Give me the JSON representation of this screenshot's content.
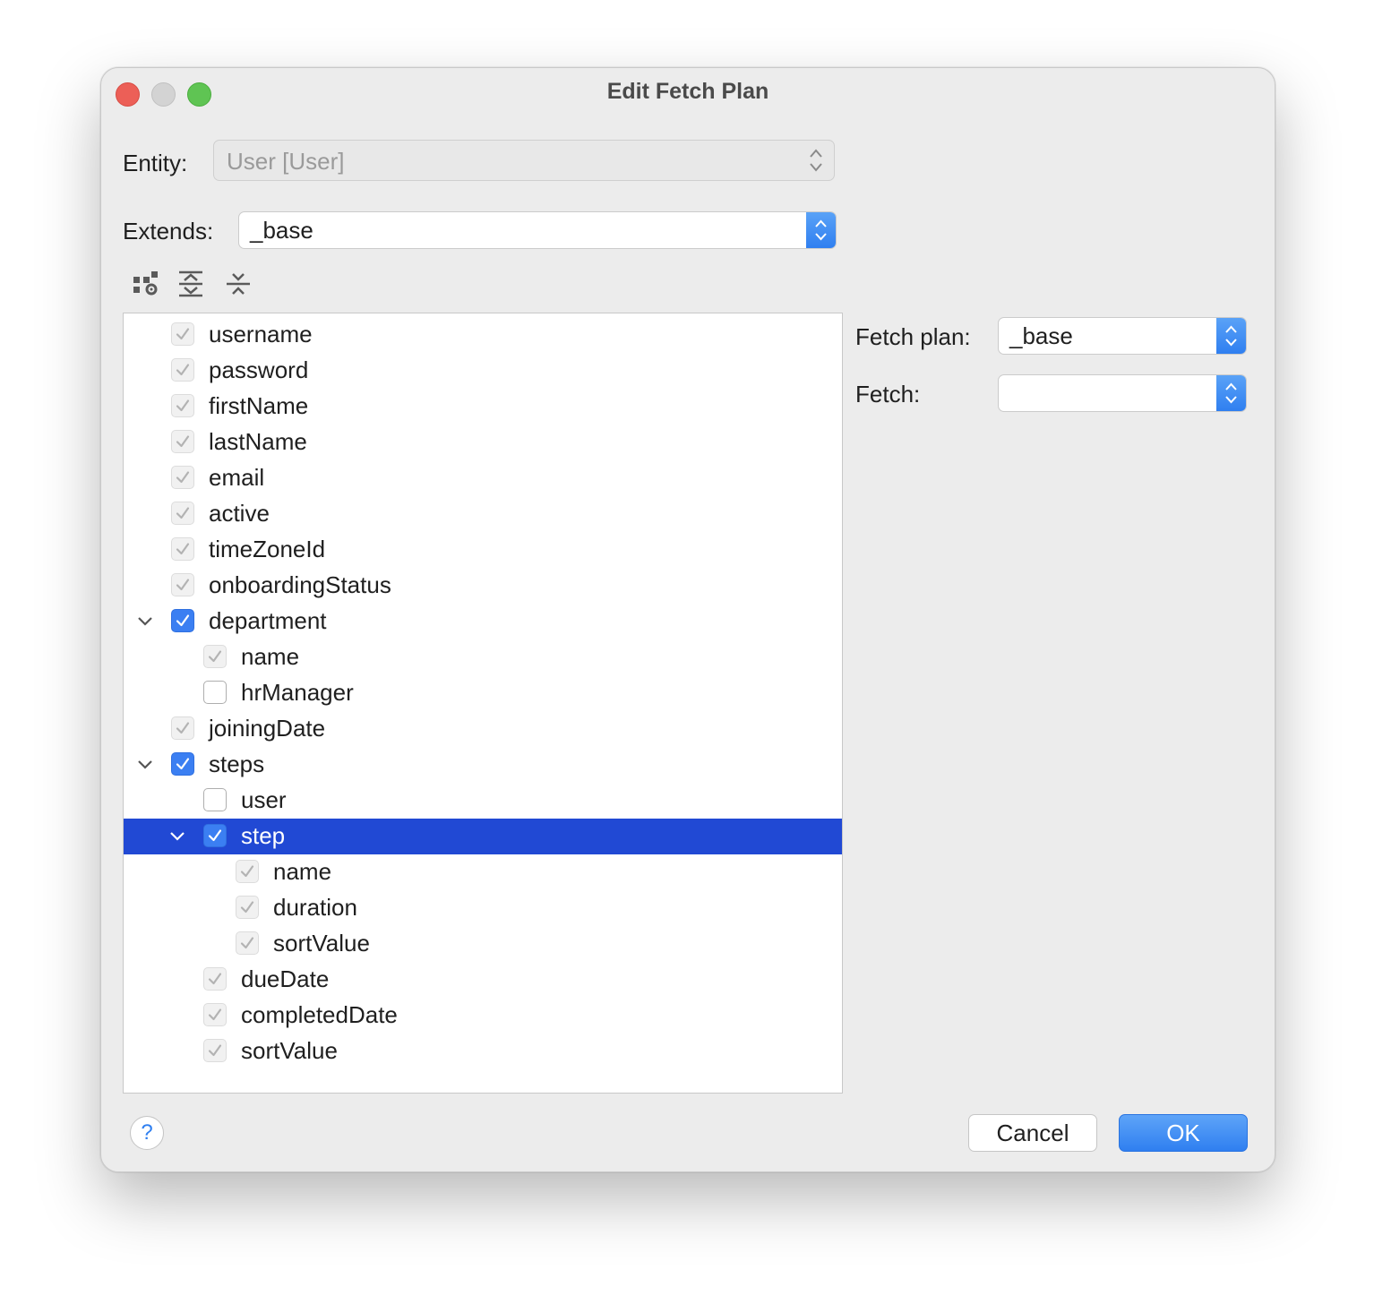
{
  "window": {
    "title": "Edit Fetch Plan"
  },
  "form": {
    "entity_label": "Entity:",
    "entity_value": "User [User]",
    "extends_label": "Extends:",
    "extends_value": "_base"
  },
  "toolbar": {
    "icons": [
      "hierarchy-settings-icon",
      "expand-all-icon",
      "collapse-all-icon"
    ]
  },
  "tree": {
    "rows": [
      {
        "label": "username",
        "level": 0,
        "state": "inherited"
      },
      {
        "label": "password",
        "level": 0,
        "state": "inherited"
      },
      {
        "label": "firstName",
        "level": 0,
        "state": "inherited"
      },
      {
        "label": "lastName",
        "level": 0,
        "state": "inherited"
      },
      {
        "label": "email",
        "level": 0,
        "state": "inherited"
      },
      {
        "label": "active",
        "level": 0,
        "state": "inherited"
      },
      {
        "label": "timeZoneId",
        "level": 0,
        "state": "inherited"
      },
      {
        "label": "onboardingStatus",
        "level": 0,
        "state": "inherited"
      },
      {
        "label": "department",
        "level": 0,
        "state": "checked",
        "expanded": true
      },
      {
        "label": "name",
        "level": 1,
        "state": "inherited"
      },
      {
        "label": "hrManager",
        "level": 1,
        "state": "empty"
      },
      {
        "label": "joiningDate",
        "level": 0,
        "state": "inherited"
      },
      {
        "label": "steps",
        "level": 0,
        "state": "checked",
        "expanded": true
      },
      {
        "label": "user",
        "level": 1,
        "state": "empty"
      },
      {
        "label": "step",
        "level": 1,
        "state": "checked",
        "expanded": true,
        "selected": true
      },
      {
        "label": "name",
        "level": 2,
        "state": "inherited"
      },
      {
        "label": "duration",
        "level": 2,
        "state": "inherited"
      },
      {
        "label": "sortValue",
        "level": 2,
        "state": "inherited"
      },
      {
        "label": "dueDate",
        "level": 1,
        "state": "inherited"
      },
      {
        "label": "completedDate",
        "level": 1,
        "state": "inherited"
      },
      {
        "label": "sortValue",
        "level": 1,
        "state": "inherited"
      }
    ]
  },
  "properties": {
    "fetch_plan_label": "Fetch plan:",
    "fetch_plan_value": "_base",
    "fetch_label": "Fetch:",
    "fetch_value": ""
  },
  "buttons": {
    "help": "?",
    "cancel": "Cancel",
    "ok": "OK"
  },
  "colors": {
    "accent": "#2f7ff0",
    "selection": "#2149d4",
    "window_bg": "#ececec"
  }
}
